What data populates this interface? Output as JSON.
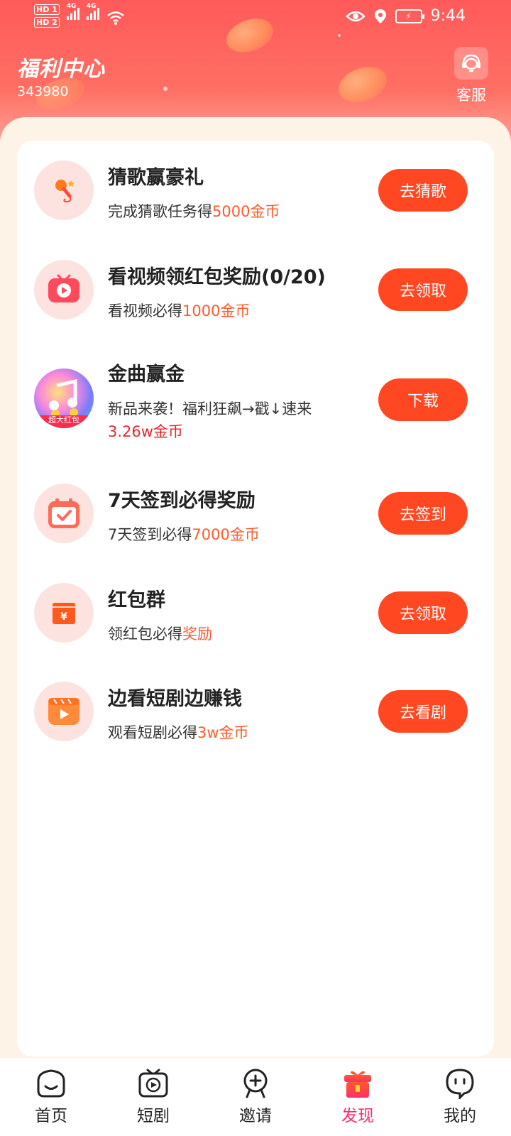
{
  "status_bar": {
    "hd1": "HD 1",
    "hd2": "HD 2",
    "net1": "4G",
    "net2": "4G",
    "time": "9:44"
  },
  "header": {
    "title": "福利中心",
    "user_id": "343980",
    "service_label": "客服"
  },
  "tasks": [
    {
      "title": "猜歌赢豪礼",
      "desc_prefix": "完成猜歌任务得",
      "desc_highlight": "5000金币",
      "button": "去猜歌",
      "icon": "microphone-icon"
    },
    {
      "title": "看视频领红包奖励(0/20)",
      "desc_prefix": "看视频必得",
      "desc_highlight": "1000金币",
      "button": "去领取",
      "icon": "play-video-icon"
    },
    {
      "title": "金曲赢金",
      "desc_prefix": "新品来袭！福利狂飙→戳↓速来",
      "desc_highlight": "3.26w金币",
      "button": "下载",
      "icon": "music-app-icon",
      "badge": "超大红包"
    },
    {
      "title": "7天签到必得奖励",
      "desc_prefix": "7天签到必得",
      "desc_highlight": "7000金币",
      "button": "去签到",
      "icon": "calendar-check-icon"
    },
    {
      "title": "红包群",
      "desc_prefix": "领红包必得",
      "desc_highlight": "奖励",
      "button": "去领取",
      "icon": "red-envelope-icon"
    },
    {
      "title": "边看短剧边赚钱",
      "desc_prefix": "观看短剧必得",
      "desc_highlight": "3w金币",
      "button": "去看剧",
      "icon": "film-play-icon"
    }
  ],
  "nav": [
    {
      "label": "首页",
      "icon": "home-icon",
      "active": false
    },
    {
      "label": "短剧",
      "icon": "tv-play-icon",
      "active": false
    },
    {
      "label": "邀请",
      "icon": "invite-icon",
      "active": false
    },
    {
      "label": "发现",
      "icon": "gift-icon",
      "active": true
    },
    {
      "label": "我的",
      "icon": "profile-icon",
      "active": false
    }
  ],
  "colors": {
    "header_red": "#ff5a5a",
    "button_red": "#ff4722",
    "highlight": "#ff5a2b",
    "active_tab": "#ff2d6a",
    "sheet_bg": "#fdf3e6"
  }
}
